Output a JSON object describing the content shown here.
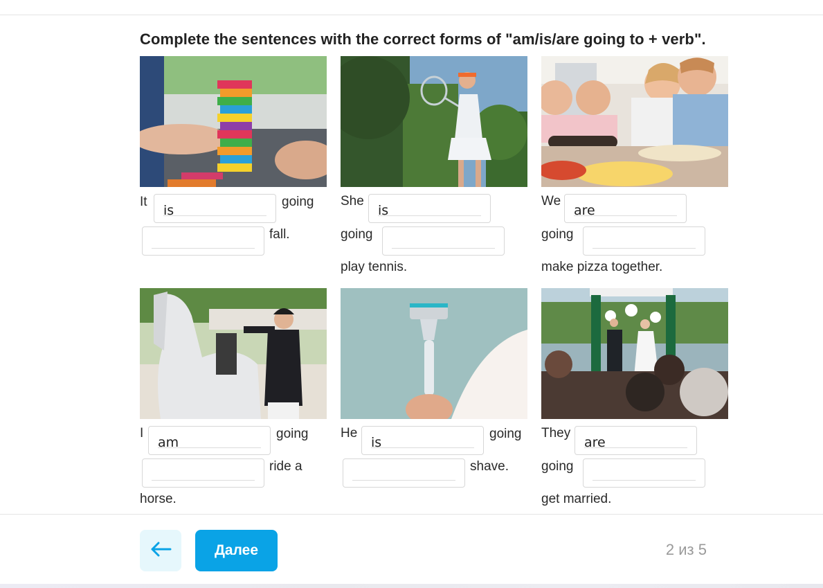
{
  "instruction": "Complete the sentences with the correct forms of \"am/is/are going to + verb\".",
  "cards": [
    {
      "subject": "It",
      "answer1": "is",
      "middle": "going",
      "answer2": "",
      "ending": "fall.",
      "tail": ""
    },
    {
      "subject": "She",
      "answer1": "is",
      "middle": "going",
      "answer2": "",
      "ending": "play tennis.",
      "tail": ""
    },
    {
      "subject": "We",
      "answer1": "are",
      "middle": "going",
      "answer2": "",
      "ending": "make pizza together.",
      "tail": ""
    },
    {
      "subject": "I",
      "answer1": "am",
      "middle": "going",
      "answer2": "",
      "ending": "ride a",
      "tail": "horse."
    },
    {
      "subject": "He",
      "answer1": "is",
      "middle": "going",
      "answer2": "",
      "ending": "shave.",
      "tail": ""
    },
    {
      "subject": "They",
      "answer1": "are",
      "middle": "going",
      "answer2": "",
      "ending": "get married.",
      "tail": ""
    }
  ],
  "photos": [
    "jenga-tower-photo",
    "tennis-player-photo",
    "kids-making-pizza-photo",
    "rider-with-horse-photo",
    "razor-in-hand-photo",
    "wedding-ceremony-photo"
  ],
  "footer": {
    "next_label": "Далее",
    "progress_text": "2 из 5",
    "back_icon": "arrow-left-icon"
  },
  "colors": {
    "accent": "#0aa3e6",
    "back_button_bg": "#e6f7fc",
    "progress_text": "#9a9a9a"
  }
}
